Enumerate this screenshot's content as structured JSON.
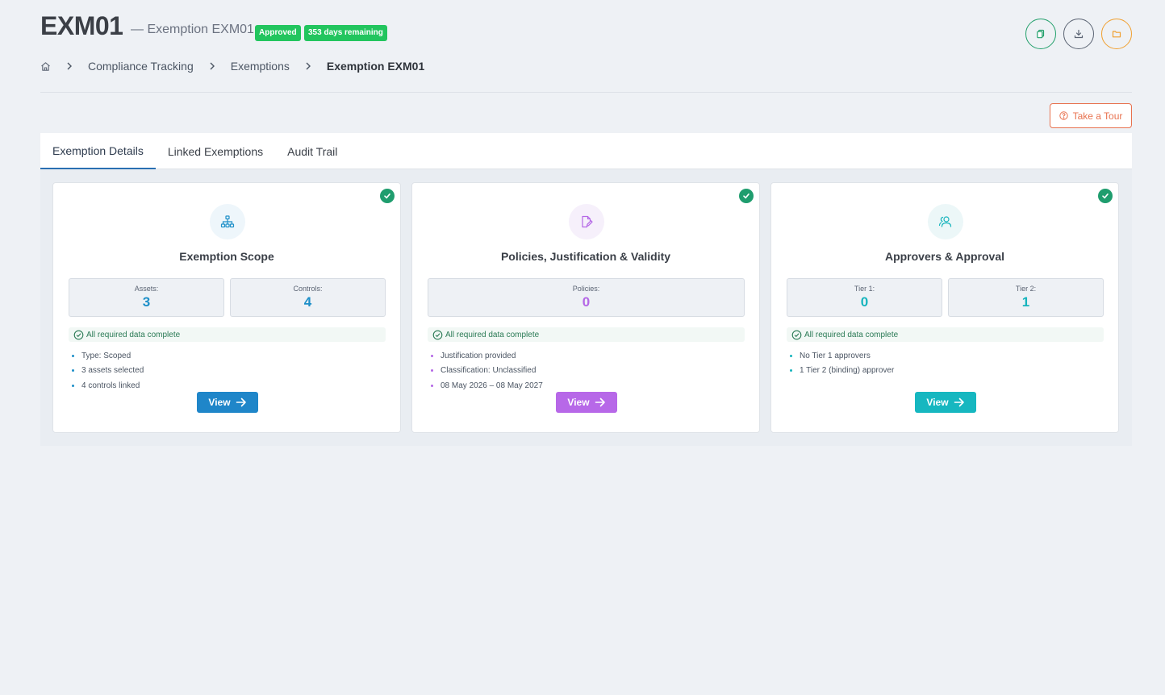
{
  "header": {
    "title": "EXM01",
    "subtitle": "— Exemption EXM01",
    "status_badge": "Approved",
    "days_badge": "353 days remaining"
  },
  "actions": [
    {
      "icon": "copy-icon",
      "color": "#22a06b"
    },
    {
      "icon": "download-icon",
      "color": "#5b6473"
    },
    {
      "icon": "folder-icon",
      "color": "#f0a030"
    }
  ],
  "breadcrumb": {
    "home_icon": "home-icon",
    "items": [
      "Compliance Tracking",
      "Exemptions",
      "Exemption EXM01"
    ]
  },
  "tour_button": {
    "label": "Take a Tour",
    "icon": "help-circle-icon"
  },
  "tabs": [
    {
      "label": "Exemption Details",
      "active": true
    },
    {
      "label": "Linked Exemptions",
      "active": false
    },
    {
      "label": "Audit Trail",
      "active": false
    }
  ],
  "cards": [
    {
      "title": "Exemption Scope",
      "icon": "hierarchy-icon",
      "accent": "#1d8fc8",
      "stats": [
        {
          "label": "Assets:",
          "value": "3"
        },
        {
          "label": "Controls:",
          "value": "4"
        }
      ],
      "status": "All required data complete",
      "bullets": [
        "Type: Scoped",
        "3 assets selected",
        "4 controls linked"
      ],
      "button": "View"
    },
    {
      "title": "Policies, Justification & Validity",
      "icon": "document-edit-icon",
      "accent": "#b467e6",
      "stats": [
        {
          "label": "Policies:",
          "value": "0"
        }
      ],
      "status": "All required data complete",
      "bullets": [
        "Justification provided",
        "Classification: Unclassified",
        "08 May 2026 – 08 May 2027"
      ],
      "button": "View"
    },
    {
      "title": "Approvers & Approval",
      "icon": "users-icon",
      "accent": "#16b4bd",
      "stats": [
        {
          "label": "Tier 1:",
          "value": "0"
        },
        {
          "label": "Tier 2:",
          "value": "1"
        }
      ],
      "status": "All required data complete",
      "bullets": [
        "No Tier 1 approvers",
        "1 Tier 2 (binding) approver"
      ],
      "button": "View"
    }
  ]
}
